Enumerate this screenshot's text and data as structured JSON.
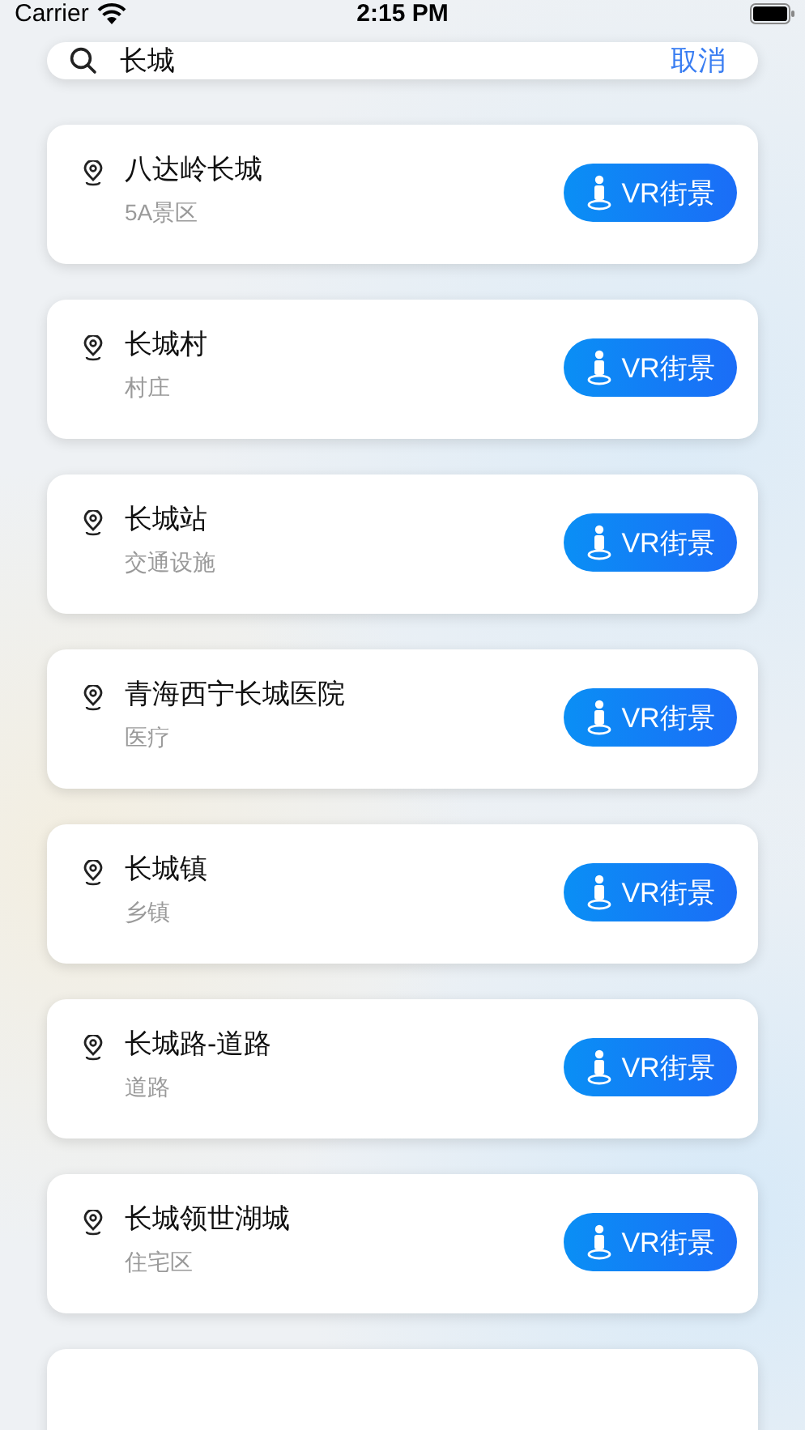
{
  "status_bar": {
    "carrier": "Carrier",
    "time": "2:15 PM"
  },
  "search": {
    "value": "长城",
    "cancel": "取消"
  },
  "results": [
    {
      "name": "八达岭长城",
      "category": "5A景区",
      "button": "VR街景"
    },
    {
      "name": "长城村",
      "category": "村庄",
      "button": "VR街景"
    },
    {
      "name": "长城站",
      "category": "交通设施",
      "button": "VR街景"
    },
    {
      "name": "青海西宁长城医院",
      "category": "医疗",
      "button": "VR街景"
    },
    {
      "name": "长城镇",
      "category": "乡镇",
      "button": "VR街景"
    },
    {
      "name": "长城路-道路",
      "category": "道路",
      "button": "VR街景"
    },
    {
      "name": "长城领世湖城",
      "category": "住宅区",
      "button": "VR街景"
    }
  ]
}
